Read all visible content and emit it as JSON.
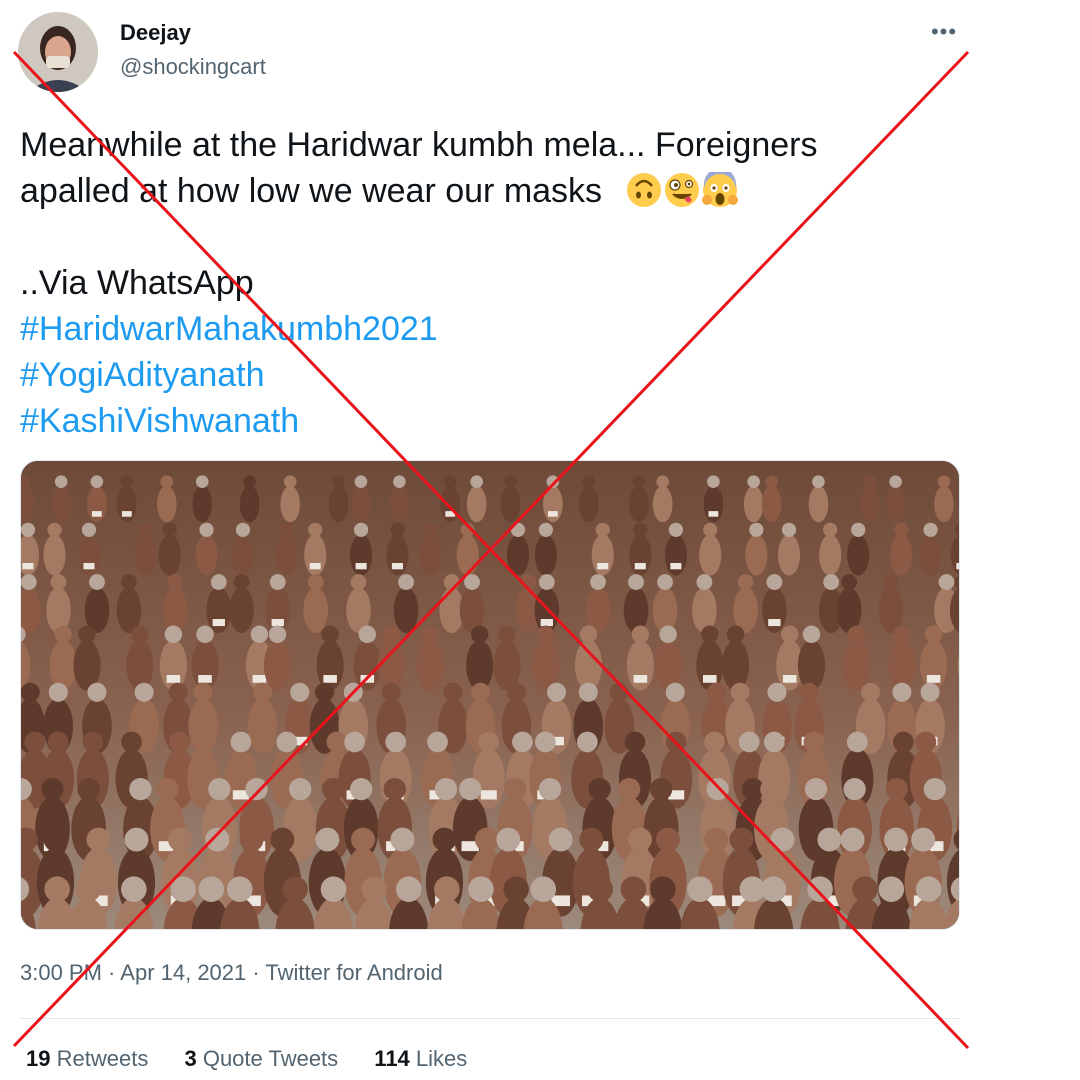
{
  "author": {
    "display_name": "Deejay",
    "handle": "@shockingcart"
  },
  "more_label": "•••",
  "tweet": {
    "line1": "Meanwhile at the Haridwar kumbh mela... Foreigners",
    "line2": "apalled at how low we wear our masks",
    "line3": "..Via WhatsApp",
    "hashtags": [
      "#HaridwarMahakumbh2021",
      "#YogiAdityanath",
      "#KashiVishwanath"
    ],
    "emojis": [
      "upside-down-face-emoji",
      "zany-face-emoji",
      "face-screaming-in-fear-emoji"
    ]
  },
  "media": {
    "description_icon": "photo-crowd"
  },
  "meta": {
    "time": "3:00 PM",
    "separator": " · ",
    "date": "Apr 14, 2021",
    "source": "Twitter for Android"
  },
  "stats": {
    "retweets_count": "19",
    "retweets_label": "Retweets",
    "quotes_count": "3",
    "quotes_label": "Quote Tweets",
    "likes_count": "114",
    "likes_label": "Likes"
  },
  "colors": {
    "hashtag": "#1d9bf0",
    "secondary_text": "#536471",
    "cross": "#e8141c"
  }
}
